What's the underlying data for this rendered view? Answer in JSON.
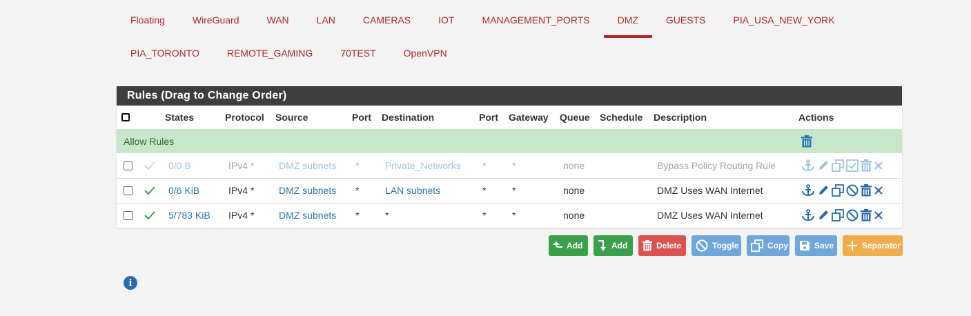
{
  "tabs": {
    "row1": [
      "Floating",
      "WireGuard",
      "WAN",
      "LAN",
      "CAMERAS",
      "IOT",
      "MANAGEMENT_PORTS",
      "DMZ",
      "GUESTS",
      "PIA_USA_NEW_YORK"
    ],
    "row2": [
      "PIA_TORONTO",
      "REMOTE_GAMING",
      "70TEST",
      "OpenVPN"
    ],
    "active": "DMZ"
  },
  "panel": {
    "title": "Rules (Drag to Change Order)"
  },
  "table": {
    "headers": {
      "states": "States",
      "protocol": "Protocol",
      "source": "Source",
      "port": "Port",
      "destination": "Destination",
      "port2": "Port",
      "gateway": "Gateway",
      "queue": "Queue",
      "schedule": "Schedule",
      "description": "Description",
      "actions": "Actions"
    },
    "separator": "Allow Rules",
    "rows": [
      {
        "states": "0/0 B",
        "protocol": "IPv4 *",
        "source": "DMZ subnets",
        "src_port": "*",
        "destination": "Private_Networks",
        "dst_port": "*",
        "gateway": "*",
        "queue": "none",
        "schedule": "",
        "description": "Bypass Policy Routing Rule",
        "enabled": false
      },
      {
        "states": "0/6 KiB",
        "protocol": "IPv4 *",
        "source": "DMZ subnets",
        "src_port": "*",
        "destination": "LAN subnets",
        "dst_port": "*",
        "gateway": "*",
        "queue": "none",
        "schedule": "",
        "description": "DMZ Uses WAN Internet",
        "enabled": true
      },
      {
        "states": "5/783 KiB",
        "protocol": "IPv4 *",
        "source": "DMZ subnets",
        "src_port": "*",
        "destination": "*",
        "dst_port": "*",
        "gateway": "*",
        "queue": "none",
        "schedule": "",
        "description": "DMZ Uses WAN Internet",
        "enabled": true
      }
    ]
  },
  "buttons": {
    "add_top": "Add",
    "add_bottom": "Add",
    "delete": "Delete",
    "toggle": "Toggle",
    "copy": "Copy",
    "save": "Save",
    "separator": "Separator"
  },
  "colors": {
    "tab_text": "#b02828",
    "header_bg": "#3d3d3d",
    "separator_bg": "#c8e6c9",
    "link": "#2a76b0",
    "add": "#3aa14a",
    "delete": "#d9534f",
    "secondary": "#6fa7db",
    "separator_btn": "#f0ad4e"
  },
  "icons": {
    "row_actions": [
      "anchor-icon",
      "pencil-icon",
      "copy-icon",
      "block-icon",
      "trash-icon",
      "close-icon"
    ],
    "row_actions_disabled": [
      "anchor-icon",
      "pencil-icon",
      "copy-icon",
      "checkbox-icon",
      "trash-icon",
      "close-icon"
    ],
    "separator_action": "trash-icon",
    "info": "info-icon"
  }
}
